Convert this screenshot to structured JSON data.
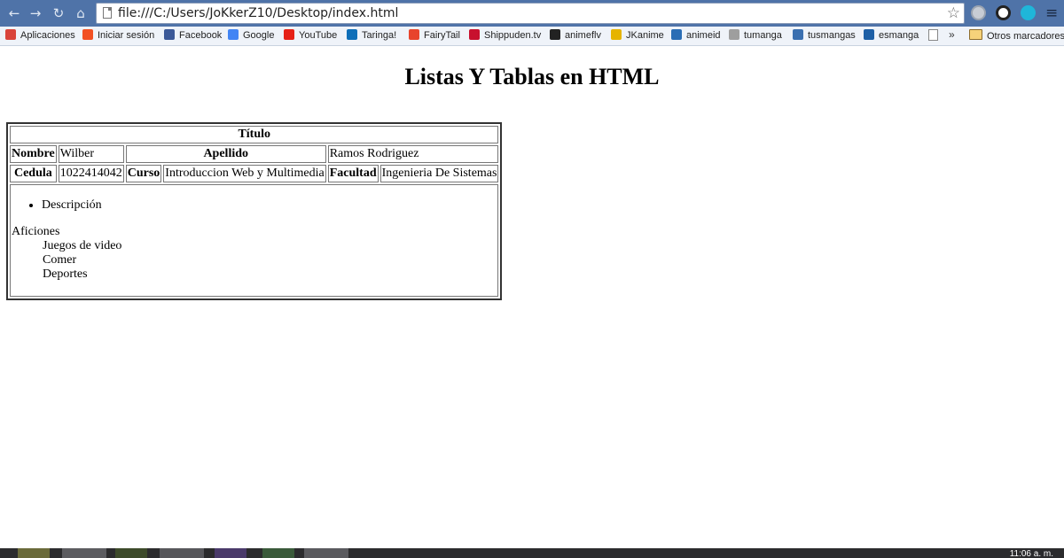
{
  "browser": {
    "url": "file:///C:/Users/JoKkerZ10/Desktop/index.html",
    "bookmarks": [
      {
        "label": "Aplicaciones",
        "color": "#d9443a"
      },
      {
        "label": "Iniciar sesión",
        "color": "#f25022"
      },
      {
        "label": "Facebook",
        "color": "#3b5998"
      },
      {
        "label": "Google",
        "color": "#4285f4"
      },
      {
        "label": "YouTube",
        "color": "#e62117"
      },
      {
        "label": "Taringa!",
        "color": "#0e6eb8"
      },
      {
        "label": "FairyTail",
        "color": "#e8442c"
      },
      {
        "label": "Shippuden.tv",
        "color": "#c8102e"
      },
      {
        "label": "animeflv",
        "color": "#222222"
      },
      {
        "label": "JKanime",
        "color": "#e6b400"
      },
      {
        "label": "animeid",
        "color": "#2a6db5"
      },
      {
        "label": "tumanga",
        "color": "#9e9e9e"
      },
      {
        "label": "tusmangas",
        "color": "#3a6fb0"
      },
      {
        "label": "esmanga",
        "color": "#1d5fa6"
      }
    ],
    "other_bookmarks": "Otros marcadores",
    "overflow": "»"
  },
  "page": {
    "title": "Listas Y Tablas en HTML",
    "table": {
      "header": "Título",
      "row1": {
        "nombre_label": "Nombre",
        "nombre_value": "Wilber",
        "apellido_label": "Apellido",
        "apellido_value": "Ramos Rodriguez"
      },
      "row2": {
        "cedula_label": "Cedula",
        "cedula_value": "1022414042",
        "curso_label": "Curso",
        "curso_value": "Introduccion Web y Multimedia",
        "facultad_label": "Facultad",
        "facultad_value": "Ingenieria De Sistemas"
      },
      "list_item": "Descripción",
      "aficiones_term": "Aficiones",
      "aficiones": [
        "Juegos de video",
        "Comer",
        "Deportes"
      ]
    }
  },
  "taskbar": {
    "clock": "11:06 a. m."
  }
}
